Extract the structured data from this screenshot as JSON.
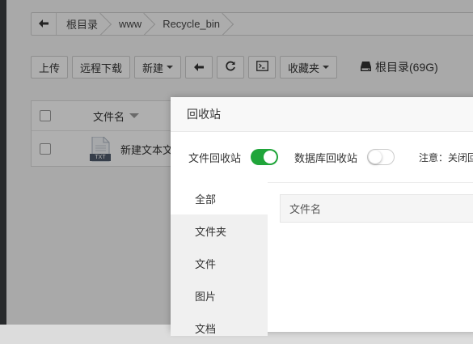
{
  "breadcrumb": {
    "back_icon": "arrow-left-icon",
    "items": [
      "根目录",
      "www",
      "Recycle_bin"
    ]
  },
  "toolbar": {
    "upload": "上传",
    "remote_download": "远程下载",
    "new": "新建",
    "back_icon": "arrow-left-icon",
    "refresh_icon": "refresh-icon",
    "terminal_icon": "terminal-icon",
    "favorites": "收藏夹",
    "disk_label": "根目录(69G)",
    "disk_icon": "hard-drive-icon"
  },
  "file_table": {
    "column_name": "文件名",
    "rows": [
      {
        "name": "新建文本文档",
        "type_label": "TXT"
      }
    ]
  },
  "modal": {
    "title": "回收站",
    "file_recycle_label": "文件回收站",
    "file_recycle_on": true,
    "db_recycle_label": "数据库回收站",
    "db_recycle_on": false,
    "notice": "注意：关闭回",
    "sidebar": [
      "全部",
      "文件夹",
      "文件",
      "图片",
      "文档"
    ],
    "content_header": "文件名"
  },
  "colors": {
    "accent_green": "#20a53a",
    "dark_strip": "#3a3d40"
  }
}
